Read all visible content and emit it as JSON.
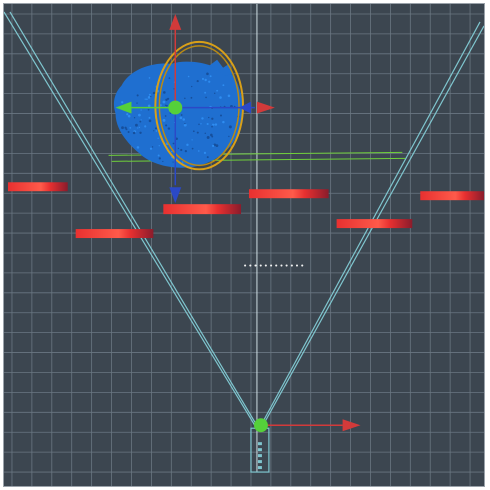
{
  "viewport": {
    "name": "3d-scene-viewport",
    "background_color": "#3c4650",
    "grid_color": "#6a7782",
    "grid_major_color": "#7f8b95"
  },
  "scene": {
    "camera_frustum": {
      "color": "#7fc6cf"
    },
    "point_cloud": {
      "color": "#1f6fd0",
      "highlight_color": "#2e8cf0"
    },
    "gizmo_top": {
      "x_axis_color": "#d23a3a",
      "y_axis_color": "#d23a3a",
      "z_axis_color": "#2b49c7",
      "center_color": "#55d03a",
      "rotate_ring_color": "#d9a018"
    },
    "gizmo_bottom": {
      "x_axis_color": "#d23a3a",
      "center_color": "#55d03a"
    },
    "guide_line_color": "#6fcf3a",
    "red_segments_color": "#e83030",
    "red_segments_dark_color": "#8a1c2c",
    "text_label": "••••••••••••"
  }
}
